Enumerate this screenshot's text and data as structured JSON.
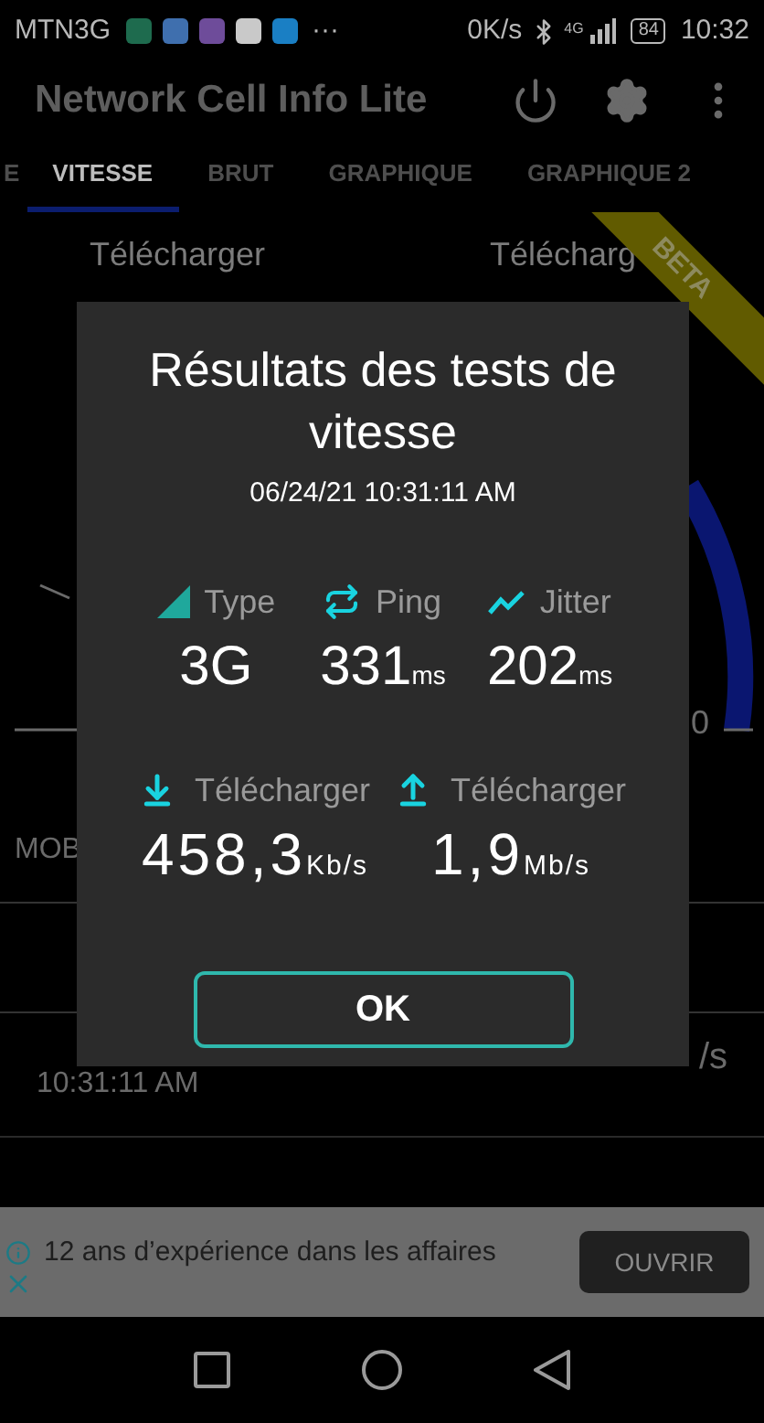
{
  "status_bar": {
    "carrier": "MTN3G",
    "more": "···",
    "speed": "0K/s",
    "network": "4G",
    "battery": "84",
    "time": "10:32"
  },
  "app_bar": {
    "title": "Network Cell Info Lite"
  },
  "tabs": [
    {
      "label": "E",
      "selected": false
    },
    {
      "label": "VITESSE",
      "selected": true
    },
    {
      "label": "BRUT",
      "selected": false
    },
    {
      "label": "GRAPHIQUE",
      "selected": false
    },
    {
      "label": "GRAPHIQUE 2",
      "selected": false
    }
  ],
  "badge": "BETA",
  "background": {
    "labels": [
      "Télécharger",
      "Télécharg"
    ],
    "gauge_label": "0",
    "section": "MOB",
    "history_time": "10:31:11 AM",
    "history_unit": "/s"
  },
  "dialog": {
    "title": "Résultats des tests de vitesse",
    "date": "06/24/21 10:31:11 AM",
    "metrics": [
      {
        "kind": "type",
        "label": "Type",
        "value": "3G"
      },
      {
        "kind": "ping",
        "label": "Ping",
        "value": "331",
        "unit": "ms"
      },
      {
        "kind": "jitter",
        "label": "Jitter",
        "value": "202",
        "unit": "ms"
      }
    ],
    "transfers": [
      {
        "kind": "download",
        "label": "Télécharger",
        "value": "458,3",
        "unit": "Kb/s"
      },
      {
        "kind": "upload",
        "label": "Télécharger",
        "value": "1,9",
        "unit": "Mb/s"
      }
    ],
    "button": "OK"
  },
  "ad": {
    "text": "12 ans d’expérience dans les affaires",
    "button": "OUVRIR"
  }
}
